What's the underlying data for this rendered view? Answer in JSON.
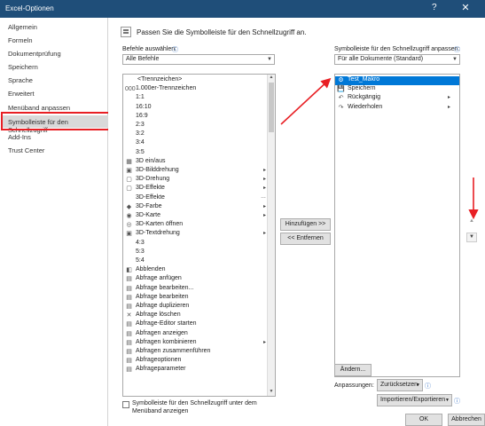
{
  "window": {
    "title": "Excel-Optionen",
    "help": "?",
    "close": "✕"
  },
  "nav": {
    "items": [
      "Allgemein",
      "Formeln",
      "Dokumentprüfung",
      "Speichern",
      "Sprache",
      "Erweitert",
      "Menüband anpassen",
      "Symbolleiste für den Schnellzugriff",
      "Add-Ins",
      "Trust Center"
    ],
    "selected_index": 7
  },
  "header": {
    "text": "Passen Sie die Symbolleiste für den Schnellzugriff an."
  },
  "left": {
    "label": "Befehle auswählen:",
    "combo_value": "Alle Befehle",
    "items": [
      {
        "label": "<Trennzeichen>",
        "icon": ""
      },
      {
        "label": "1.000er-Trennzeichen",
        "icon": "000"
      },
      {
        "label": "1:1",
        "icon": ""
      },
      {
        "label": "16:10",
        "icon": ""
      },
      {
        "label": "16:9",
        "icon": ""
      },
      {
        "label": "2:3",
        "icon": ""
      },
      {
        "label": "3:2",
        "icon": ""
      },
      {
        "label": "3:4",
        "icon": ""
      },
      {
        "label": "3:5",
        "icon": ""
      },
      {
        "label": "3D ein/aus",
        "icon": "▦"
      },
      {
        "label": "3D-Bilddrehung",
        "icon": "▣",
        "sub": "▸"
      },
      {
        "label": "3D-Drehung",
        "icon": "▢",
        "sub": "▸"
      },
      {
        "label": "3D-Effekte",
        "icon": "▢",
        "sub": "▸"
      },
      {
        "label": "3D-Effekte",
        "icon": "",
        "sub": "…"
      },
      {
        "label": "3D-Farbe",
        "icon": "◆",
        "sub": "▸"
      },
      {
        "label": "3D-Karte",
        "icon": "◉",
        "sub": "▸"
      },
      {
        "label": "3D-Karten öffnen",
        "icon": "◎"
      },
      {
        "label": "3D-Textdrehung",
        "icon": "▣",
        "sub": "▸"
      },
      {
        "label": "4:3",
        "icon": ""
      },
      {
        "label": "5:3",
        "icon": ""
      },
      {
        "label": "5:4",
        "icon": ""
      },
      {
        "label": "Abblenden",
        "icon": "◧"
      },
      {
        "label": "Abfrage anfügen",
        "icon": "▤"
      },
      {
        "label": "Abfrage bearbeiten...",
        "icon": "▤"
      },
      {
        "label": "Abfrage bearbeiten",
        "icon": "▤"
      },
      {
        "label": "Abfrage duplizieren",
        "icon": "▤"
      },
      {
        "label": "Abfrage löschen",
        "icon": "✕"
      },
      {
        "label": "Abfrage-Editor starten",
        "icon": "▤"
      },
      {
        "label": "Abfragen anzeigen",
        "icon": "▤"
      },
      {
        "label": "Abfragen kombinieren",
        "icon": "▤",
        "sub": "▸"
      },
      {
        "label": "Abfragen zusammenführen",
        "icon": "▤"
      },
      {
        "label": "Abfrageoptionen",
        "icon": "▤"
      },
      {
        "label": "Abfrageparameter",
        "icon": "▤"
      }
    ],
    "checkbox_label_1": "Symbolleiste für den Schnellzugriff unter dem",
    "checkbox_label_2": "Menüband anzeigen"
  },
  "middle": {
    "add_button": "Hinzufügen >>",
    "remove_button": "<< Entfernen"
  },
  "right": {
    "label": "Symbolleiste für den Schnellzugriff anpassen:",
    "combo_value": "Für alle Dokumente (Standard)",
    "items": [
      {
        "label": "Test_Makro",
        "icon": "⚙",
        "selected": true
      },
      {
        "label": "Speichern",
        "icon": "💾"
      },
      {
        "label": "Rückgängig",
        "icon": "↶",
        "sub": "▸"
      },
      {
        "label": "Wiederholen",
        "icon": "↷",
        "sub": "▸"
      }
    ],
    "modify_button": "Ändern...",
    "customize_label": "Anpassungen:",
    "reset_button": "Zurücksetzen",
    "import_export_button": "Importieren/Exportieren"
  },
  "footer": {
    "ok": "OK",
    "cancel": "Abbrechen"
  },
  "colors": {
    "title_bar": "#1f4e79",
    "selection": "#0078d7",
    "annotation_red": "#e81f24"
  }
}
